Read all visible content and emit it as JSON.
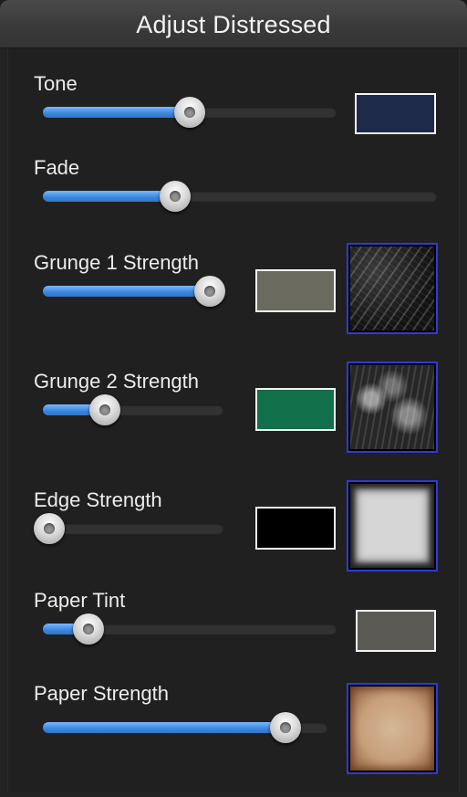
{
  "panel": {
    "title": "Adjust Distressed"
  },
  "controls": {
    "tone": {
      "label": "Tone",
      "value": 0.5,
      "swatch_color": "#1e2a4a"
    },
    "fade": {
      "label": "Fade",
      "value": 0.33
    },
    "grunge1": {
      "label": "Grunge 1 Strength",
      "value": 1.0,
      "swatch_color": "#6a6a5e",
      "texture": "grunge-1-texture"
    },
    "grunge2": {
      "label": "Grunge 2 Strength",
      "value": 0.33,
      "swatch_color": "#12704a",
      "texture": "grunge-2-texture"
    },
    "edge": {
      "label": "Edge Strength",
      "value": 0.0,
      "swatch_color": "#000000",
      "texture": "edge-texture"
    },
    "paper_tint": {
      "label": "Paper Tint",
      "value": 0.14,
      "swatch_color": "#5b5a55"
    },
    "paper_strength": {
      "label": "Paper Strength",
      "value": 0.87,
      "texture": "paper-texture"
    }
  },
  "colors": {
    "accent": "#3b86dd",
    "thumb_border": "#2d3bd6"
  }
}
